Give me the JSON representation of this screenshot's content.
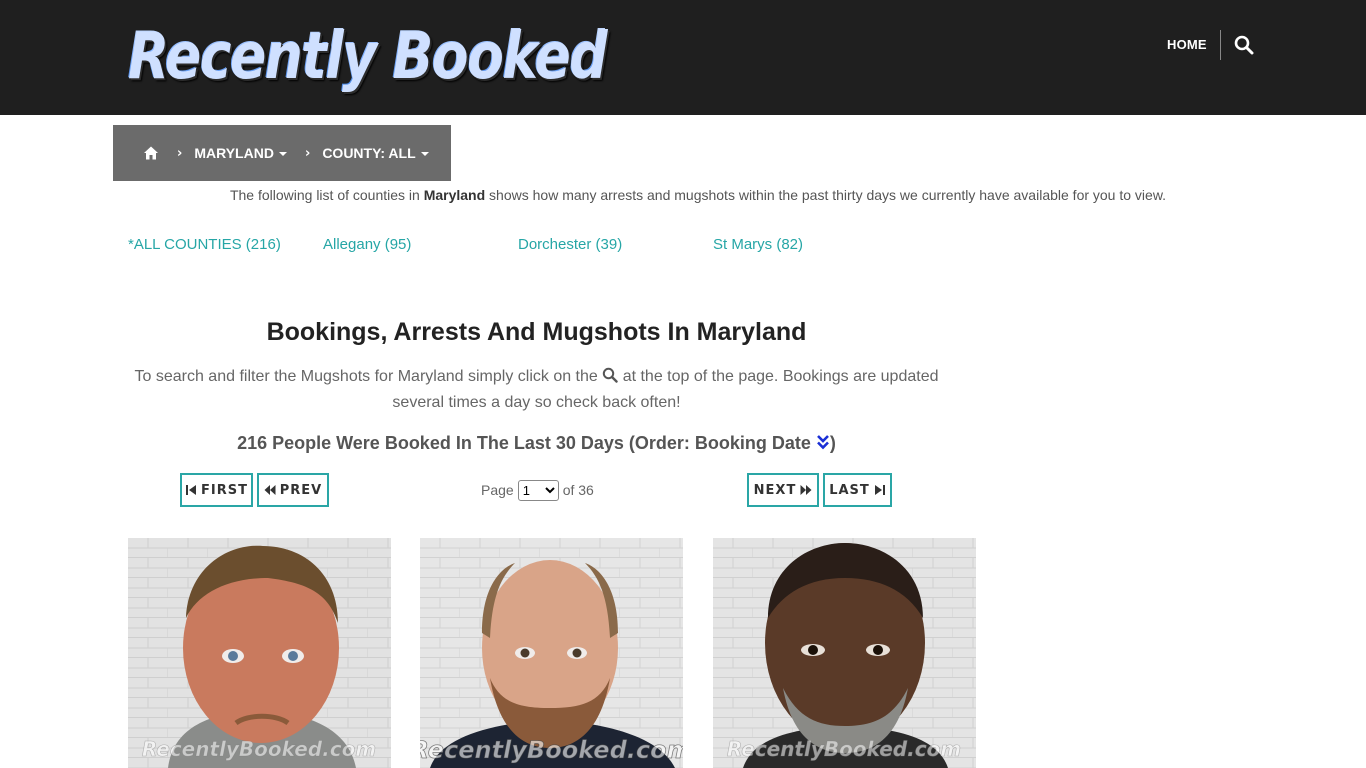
{
  "header": {
    "logo_text": "Recently Booked",
    "nav_home": "HOME",
    "search_icon": "search-icon"
  },
  "breadcrumb": {
    "home_icon": "home-icon",
    "state": "MARYLAND",
    "county": "COUNTY: ALL"
  },
  "intro": {
    "before": "The following list of counties in ",
    "state": "Maryland",
    "after": " shows how many arrests and mugshots within the past thirty days we currently have available for you to view."
  },
  "counties": [
    {
      "label": "*ALL COUNTIES (216)"
    },
    {
      "label": "Allegany (95)"
    },
    {
      "label": "Dorchester (39)"
    },
    {
      "label": "St Marys (82)"
    }
  ],
  "main": {
    "title": "Bookings, Arrests And Mugshots In Maryland",
    "desc_before": "To search and filter the Mugshots for Maryland simply click on the ",
    "desc_after": " at the top of the page. Bookings are updated several times a day so check back often!",
    "summary": "216 People Were Booked In The Last 30 Days (Order: Booking Date ",
    "summary_close": ")"
  },
  "pagination": {
    "first": "FIRST",
    "prev": "PREV",
    "next": "NEXT",
    "last": "LAST",
    "page_label": "Page",
    "current_page": "1",
    "of_label": "of 36"
  },
  "mugshots": [
    {
      "watermark": "RecentlyBooked.com"
    },
    {
      "watermark": "RecentlyBooked.com"
    },
    {
      "watermark": "RecentlyBooked.com"
    }
  ],
  "colors": {
    "header_bg": "#1f1f1f",
    "breadcrumb_bg": "#6b6b6b",
    "accent_teal": "#26a6a6",
    "order_icon": "#1a2fd6"
  }
}
